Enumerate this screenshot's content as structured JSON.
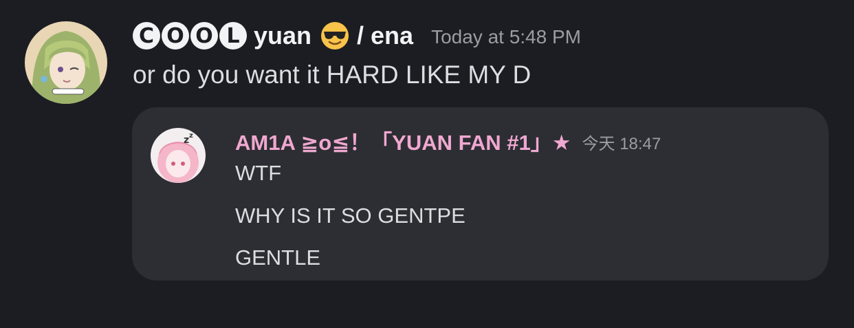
{
  "message": {
    "author": {
      "circled_letters": [
        "C",
        "O",
        "O",
        "L"
      ],
      "name_text": "yuan",
      "name_suffix": "/ ena",
      "emoji": "smiling-face-with-sunglasses-icon",
      "avatar": "green-haired-anime-avatar"
    },
    "timestamp": "Today at 5:48 PM",
    "content": "or do you want it HARD LIKE MY D"
  },
  "embed": {
    "author": "AM1A ≧o≦！「YUAN FAN  #1」★",
    "timestamp": "今天 18:47",
    "avatar": "pink-haired-anime-avatar",
    "lines": [
      "WTF",
      "WHY IS IT SO GENTPE",
      "GENTLE"
    ]
  },
  "colors": {
    "background": "#1c1d22",
    "embed_background": "#2d2e33",
    "embed_author": "#f0a8d0",
    "timestamp": "#9b9da3"
  }
}
